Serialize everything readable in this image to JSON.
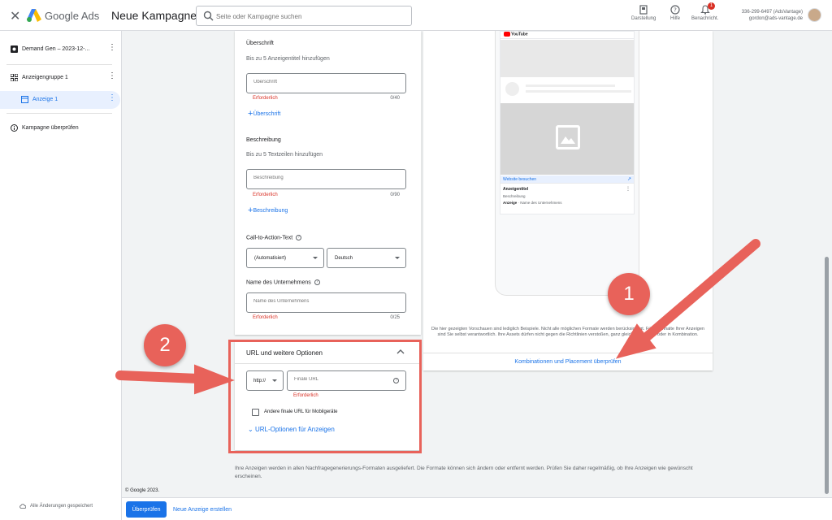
{
  "header": {
    "close_label": "✕",
    "brand": "Google Ads",
    "page_title": "Neue Kampagne",
    "search_placeholder": "Seite oder Kampagne suchen",
    "tools": [
      {
        "label": "Darstellung",
        "icon": "appearance-icon"
      },
      {
        "label": "Hilfe",
        "icon": "help-icon"
      },
      {
        "label": "Benachricht.",
        "icon": "bell-icon"
      }
    ],
    "notification_count": "1",
    "account_id": "336-299-6497 (AdsVantage)",
    "account_email": "gordon@ads-vantage.de"
  },
  "sidebar": {
    "items": [
      {
        "label": "Demand Gen – 2023-12-...",
        "icon": "campaign-icon"
      },
      {
        "label": "Anzeigengruppe 1",
        "icon": "grid-icon"
      },
      {
        "label": "Anzeige 1",
        "icon": "ad-icon"
      },
      {
        "label": "Kampagne überprüfen",
        "icon": "info-icon"
      }
    ],
    "saved_status": "Alle Änderungen gespeichert"
  },
  "form": {
    "headline": {
      "label": "Überschrift",
      "hint": "Bis zu 5 Anzeigentitel hinzufügen",
      "placeholder": "Überschrift",
      "error": "Erforderlich",
      "count": "0/40",
      "add_label": "Überschrift"
    },
    "description": {
      "label": "Beschreibung",
      "hint": "Bis zu 5 Textzeilen hinzufügen",
      "placeholder": "Beschreibung",
      "error": "Erforderlich",
      "count": "0/90",
      "add_label": "Beschreibung"
    },
    "cta": {
      "label": "Call-to-Action-Text",
      "selected": "(Automatisiert)",
      "language": "Deutsch"
    },
    "business": {
      "label": "Name des Unternehmens",
      "placeholder": "Name des Unternehmens",
      "error": "Erforderlich",
      "count": "0/25"
    }
  },
  "url_section": {
    "title": "URL und weitere Optionen",
    "protocol": "http://",
    "final_url_placeholder": "Finale URL",
    "error": "Erforderlich",
    "mobile_checkbox_label": "Andere finale URL für Mobilgeräte",
    "options_link": "URL-Optionen für Anzeigen"
  },
  "preview": {
    "app_name": "YouTube",
    "visit_label": "Website besuchen",
    "ad_title": "Anzeigentitel",
    "ad_description": "Beschreibung",
    "ad_label": "Anzeige",
    "ad_business": "· Name des Unternehmens",
    "disclaimer": "Die hier gezeigten Vorschauen sind lediglich Beispiele. Nicht alle möglichen Formate werden berücksichtigt. Für die Inhalte Ihrer Anzeigen sind Sie selbst verantwortlich. Ihre Assets dürfen nicht gegen die Richtlinien verstoßen, ganz gleich, ob einzeln oder in Kombination.",
    "review_link": "Kombinationen und Placement überprüfen"
  },
  "footnote": "Ihre Anzeigen werden in allen Nachfragegenerierungs-Formaten ausgeliefert. Die Formate können sich ändern oder entfernt werden. Prüfen Sie daher regelmäßig, ob Ihre Anzeigen wie gewünscht erscheinen.",
  "copyright": "© Google 2023.",
  "bottom_bar": {
    "primary_label": "Überprüfen",
    "secondary_label": "Neue Anzeige erstellen"
  },
  "annotations": {
    "one": "1",
    "two": "2"
  },
  "colors": {
    "accent": "#1a73e8",
    "error": "#d93025",
    "annotation": "#e8625a"
  }
}
